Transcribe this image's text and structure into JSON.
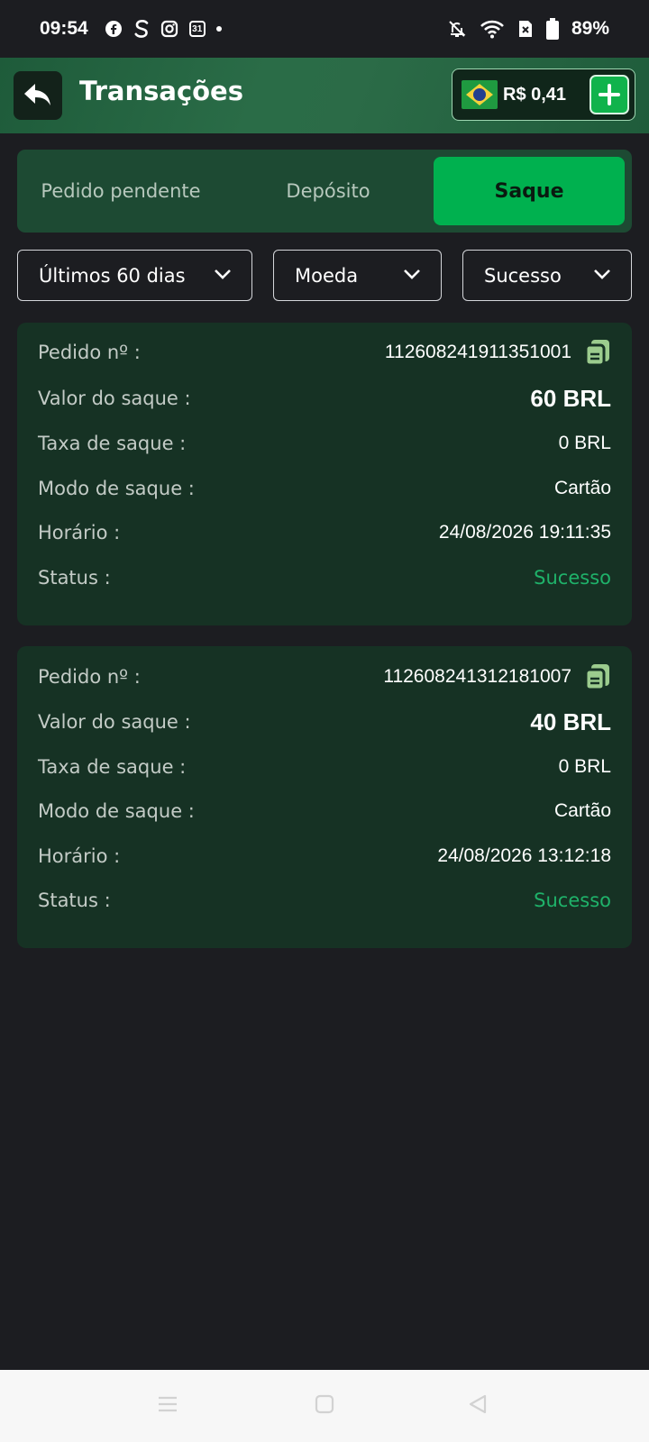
{
  "status_bar": {
    "time": "09:54",
    "calendar_day": "31",
    "battery": "89%",
    "icons": [
      "facebook-icon",
      "s-app-icon",
      "instagram-icon",
      "calendar-icon",
      "notification-dot",
      "mute-bell-icon",
      "wifi-icon",
      "sim-x-icon",
      "battery-icon"
    ]
  },
  "header": {
    "title": "Transações",
    "balance": "R$ 0,41",
    "accent": "#00b14f"
  },
  "tabs": [
    {
      "label": "Pedido pendente",
      "active": false
    },
    {
      "label": "Depósito",
      "active": false
    },
    {
      "label": "Saque",
      "active": true
    }
  ],
  "filters": {
    "period": "Últimos 60 dias",
    "currency": "Moeda",
    "status": "Sucesso"
  },
  "labels": {
    "order": "Pedido nº",
    "amount": "Valor do saque",
    "fee": "Taxa de saque",
    "mode": "Modo de saque",
    "time": "Horário",
    "status": "Status"
  },
  "transactions": [
    {
      "order_no": "112608241911351001",
      "amount": "60 BRL",
      "fee": "0 BRL",
      "mode": "Cartão",
      "time": "24/08/2026 19:11:35",
      "status": "Sucesso"
    },
    {
      "order_no": "112608241312181007",
      "amount": "40 BRL",
      "fee": "0 BRL",
      "mode": "Cartão",
      "time": "24/08/2026 13:12:18",
      "status": "Sucesso"
    }
  ],
  "colors": {
    "background": "#1c1d21",
    "card": "#163224",
    "success_text": "#1fb26a"
  }
}
